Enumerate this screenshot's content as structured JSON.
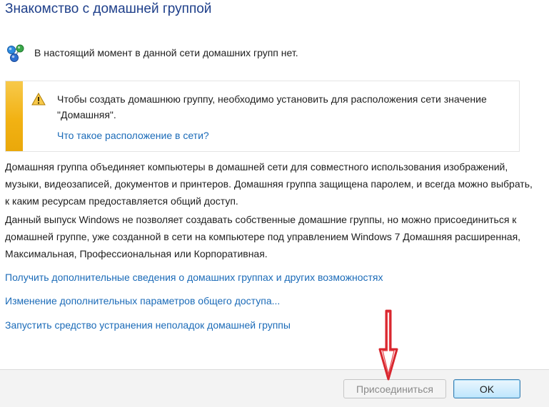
{
  "page": {
    "title": "Знакомство с домашней группой",
    "status": "В настоящий момент в данной сети домашних групп нет."
  },
  "warning": {
    "text": "Чтобы создать домашнюю группу, необходимо установить для расположения сети значение \"Домашняя\".",
    "link": "Что такое расположение в сети?"
  },
  "description": {
    "paragraph1": "Домашняя группа объединяет компьютеры в домашней сети для совместного использования изображений, музыки, видеозаписей, документов и принтеров. Домашняя группа защищена паролем, и всегда можно выбрать, к каким ресурсам предоставляется общий доступ.",
    "paragraph2": "Данный выпуск Windows не позволяет создавать собственные домашние группы, но можно присоединиться к домашней группе, уже созданной в сети на компьютере под управлением Windows 7 Домашняя расширенная, Максимальная, Профессиональная или Корпоративная."
  },
  "links": {
    "more_info": "Получить дополнительные сведения о домашних группах и других возможностях",
    "advanced_sharing": "Изменение дополнительных параметров общего доступа...",
    "troubleshooter": "Запустить средство устранения неполадок домашней группы"
  },
  "footer": {
    "join_label": "Присоединиться",
    "ok_label": "OK"
  },
  "icons": {
    "status": "network-globe-icon",
    "warning": "warning-triangle-icon",
    "annotation": "red-arrow-annotation"
  },
  "colors": {
    "title": "#1e3f8a",
    "link": "#1b6bb8",
    "warning_stripe": "#f2b213",
    "annotation_arrow": "#d8262e"
  }
}
